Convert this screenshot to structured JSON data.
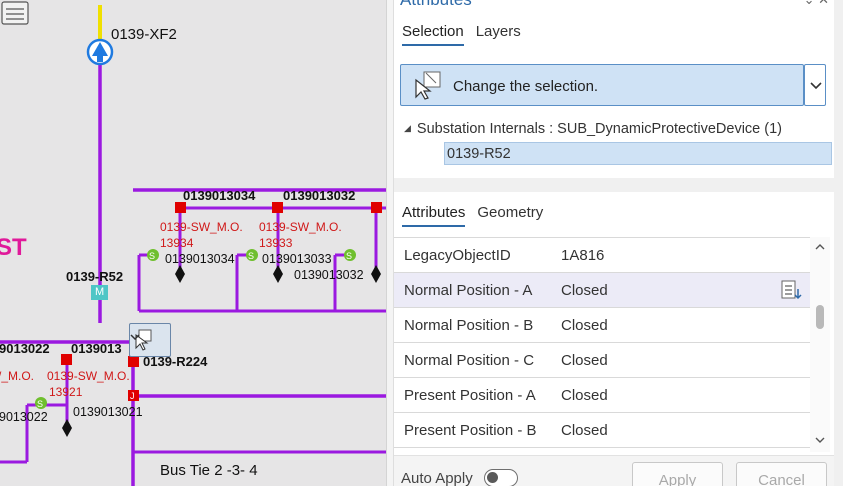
{
  "map": {
    "labels": {
      "transformer": "0139-XF2",
      "partial_west": "ST",
      "device_r52": "0139-R52",
      "device_r52_badge": "M",
      "device_r224": "0139-R224",
      "bus_tie": "Bus Tie 2 -3- 4",
      "top_id_1": "0139013034",
      "top_id_2": "0139013032",
      "switch_1_name": "0139-SW_M.O.",
      "switch_1_num": "13934",
      "switch_2_name": "0139-SW_M.O.",
      "switch_2_num": "13933",
      "node_id_1": "0139013034",
      "node_id_2": "0139013033",
      "node_id_3": "0139013032",
      "left_id_1": "9013022",
      "left_id_2": "0139013",
      "switch_3_name": "/_M.O.",
      "switch_4_name": "0139-SW_M.O.",
      "switch_4_num": "13921",
      "node_id_4": "9013022",
      "node_id_5": "0139013021",
      "switch_badge": "S",
      "fuse_badge": "J"
    },
    "colors": {
      "line": "#9b19e0",
      "switch": "#e00000",
      "switch_label": "#d01818",
      "magenta_text": "#e0199a",
      "feeder": "#f0e000",
      "transformer": "#1f7ae0",
      "green_node": "#6fbf2e",
      "cyan_badge": "#4ec6c6"
    }
  },
  "pane": {
    "title": "Attributes",
    "selection_tabs": [
      {
        "label": "Selection",
        "active": true
      },
      {
        "label": "Layers",
        "active": false
      }
    ],
    "change_selection": {
      "label": "Change the selection.",
      "icon": "pointer-select-icon"
    },
    "tree": {
      "layer": "Substation Internals : SUB_DynamicProtectiveDevice (1)",
      "feature": "0139-R52"
    },
    "attribute_tabs": [
      {
        "label": "Attributes",
        "active": true
      },
      {
        "label": "Geometry",
        "active": false
      }
    ],
    "rows": [
      {
        "field": "LegacyObjectID",
        "value": "1A816",
        "highlighted": false
      },
      {
        "field": "Normal Position - A",
        "value": "Closed",
        "highlighted": true
      },
      {
        "field": "Normal Position - B",
        "value": "Closed",
        "highlighted": false
      },
      {
        "field": "Normal Position - C",
        "value": "Closed",
        "highlighted": false
      },
      {
        "field": "Present Position - A",
        "value": "Closed",
        "highlighted": false
      },
      {
        "field": "Present Position - B",
        "value": "Closed",
        "highlighted": false
      }
    ],
    "footer": {
      "auto_apply_label": "Auto Apply",
      "auto_apply_on": false,
      "apply_label": "Apply",
      "cancel_label": "Cancel"
    },
    "colors": {
      "accent": "#2e6aa8",
      "selection_fill": "#cfe2f5",
      "row_highlight": "#ecebf7"
    }
  }
}
